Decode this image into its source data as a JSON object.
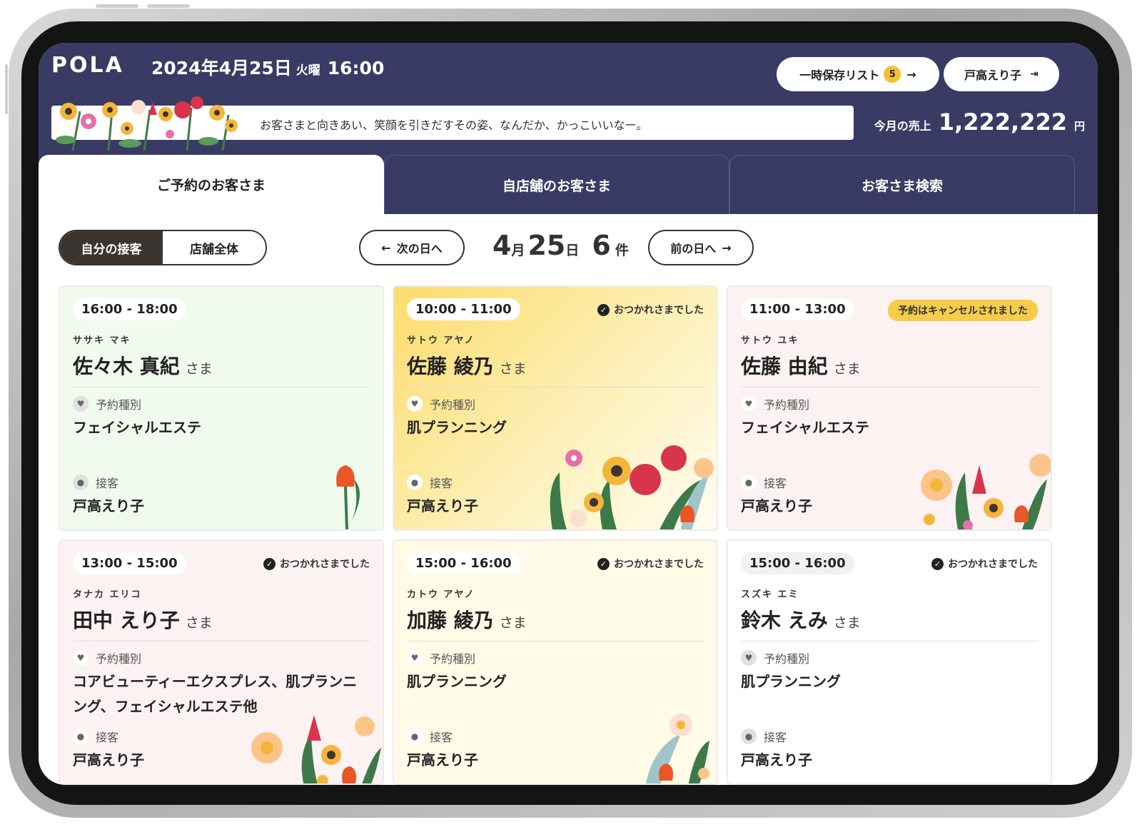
{
  "header": {
    "logo": "POLA",
    "date": "2024年4月25日",
    "weekday": "火曜",
    "time": "16:00",
    "saved_list_label": "一時保存リスト",
    "saved_list_count": "5",
    "user_name": "戸高えり子",
    "banner_message": "お客さまと向きあい、笑顔を引きだすその姿、なんだか、かっこいいなー。",
    "sales_label": "今月の売上",
    "sales_amount": "1,222,222",
    "sales_unit": "円"
  },
  "tabs": [
    {
      "label": "ご予約のお客さま",
      "active": true
    },
    {
      "label": "自店舗のお客さま",
      "active": false
    },
    {
      "label": "お客さま検索",
      "active": false
    }
  ],
  "toolbar": {
    "seg_mine": "自分の接客",
    "seg_store": "店舗全体",
    "next_day": "次の日へ",
    "prev_day": "前の日へ",
    "month": "4",
    "month_unit": "月",
    "day": "25",
    "day_unit": "日",
    "count": "6",
    "count_unit": "件"
  },
  "labels": {
    "sama": "さま",
    "type_label": "予約種別",
    "staff_label": "接客"
  },
  "appointments": [
    {
      "time": "16:00 - 18:00",
      "status": "",
      "cancel": "",
      "kana": "ササキ マキ",
      "name": "佐々木 真紀",
      "type": "フェイシャルエステ",
      "staff": "戸高えり子"
    },
    {
      "time": "10:00 - 11:00",
      "status": "おつかれさまでした",
      "cancel": "",
      "kana": "サトウ アヤノ",
      "name": "佐藤 綾乃",
      "type": "肌プランニング",
      "staff": "戸高えり子"
    },
    {
      "time": "11:00 - 13:00",
      "status": "",
      "cancel": "予約はキャンセルされました",
      "kana": "サトウ ユキ",
      "name": "佐藤 由紀",
      "type": "フェイシャルエステ",
      "staff": "戸高えり子"
    },
    {
      "time": "13:00 - 15:00",
      "status": "おつかれさまでした",
      "cancel": "",
      "kana": "タナカ エリコ",
      "name": "田中 えり子",
      "type": "コアビューティーエクスプレス、肌プランニング、フェイシャルエステ他",
      "staff": "戸高えり子"
    },
    {
      "time": "15:00 - 16:00",
      "status": "おつかれさまでした",
      "cancel": "",
      "kana": "カトウ アヤノ",
      "name": "加藤 綾乃",
      "type": "肌プランニング",
      "staff": "戸高えり子"
    },
    {
      "time": "15:00 - 16:00",
      "status": "おつかれさまでした",
      "cancel": "",
      "kana": "スズキ エミ",
      "name": "鈴木 えみ",
      "type": "肌プランニング",
      "staff": "戸高えり子"
    }
  ],
  "colors": {
    "header_bg": "#393b64",
    "badge": "#f2c130",
    "card_green": "#f0fbee",
    "card_yellow": "#fde98f",
    "card_pink": "#fdf2f2",
    "card_cream": "#fffbe6",
    "card_white": "#ffffff"
  }
}
